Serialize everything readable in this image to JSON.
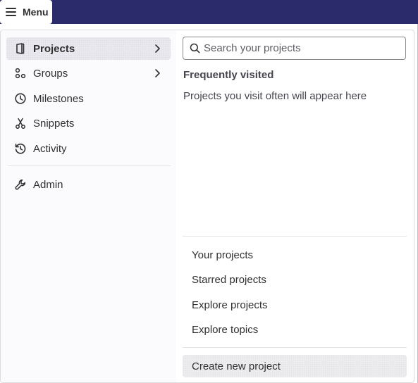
{
  "topbar": {
    "menu_button": {
      "label": "Menu",
      "icon": "hamburger-icon"
    }
  },
  "menu": {
    "left": {
      "items": [
        {
          "label": "Projects",
          "icon": "project-icon",
          "has_submenu": true,
          "active": true
        },
        {
          "label": "Groups",
          "icon": "group-icon",
          "has_submenu": true,
          "active": false
        },
        {
          "label": "Milestones",
          "icon": "clock-icon",
          "has_submenu": false,
          "active": false
        },
        {
          "label": "Snippets",
          "icon": "scissors-icon",
          "has_submenu": false,
          "active": false
        },
        {
          "label": "Activity",
          "icon": "history-icon",
          "has_submenu": false,
          "active": false
        }
      ],
      "admin": {
        "label": "Admin",
        "icon": "wrench-icon"
      }
    },
    "right": {
      "search": {
        "placeholder": "Search your projects",
        "value": ""
      },
      "frequently_visited": {
        "title": "Frequently visited",
        "empty_text": "Projects you visit often will appear here"
      },
      "links": [
        {
          "label": "Your projects"
        },
        {
          "label": "Starred projects"
        },
        {
          "label": "Explore projects"
        },
        {
          "label": "Explore topics"
        }
      ],
      "create": {
        "label": "Create new project"
      }
    }
  },
  "colors": {
    "topbar": "#2b2a6b",
    "active_item_bg": "#e9e8ee",
    "left_pane_bg": "#fbfafd",
    "text": "#303030"
  }
}
